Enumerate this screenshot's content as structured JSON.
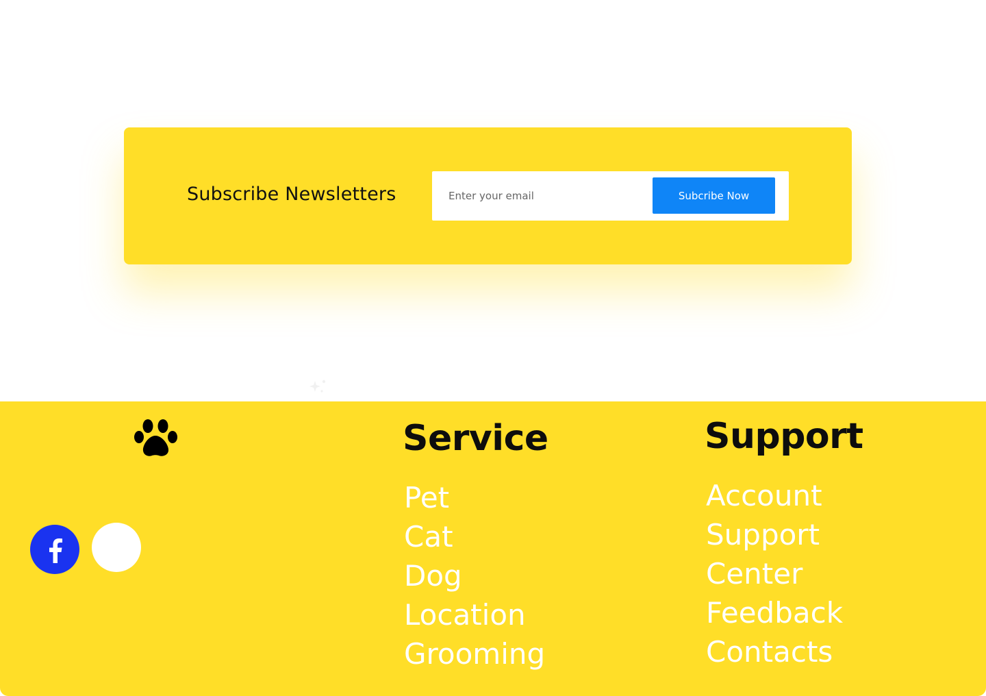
{
  "newsletter": {
    "title": "Subscribe Newsletters",
    "email_placeholder": "Enter your email",
    "email_value": "",
    "button_label": "Subcribe Now"
  },
  "footer": {
    "logo_icon": "paw-icon",
    "social": [
      {
        "icon": "facebook-icon",
        "color": "#1a33f0"
      },
      {
        "icon": "blank-social-icon",
        "color": "#ffffff"
      }
    ],
    "service": {
      "heading": "Service",
      "links": [
        "Pet",
        "Cat",
        "Dog",
        "Location",
        "Grooming"
      ]
    },
    "support": {
      "heading": "Support",
      "links": [
        "Account",
        "Support",
        "Center",
        "Feedback",
        "Contacts"
      ]
    }
  },
  "colors": {
    "accent_yellow": "#ffde28",
    "button_blue": "#0f85f7",
    "facebook_blue": "#1a33f0"
  }
}
